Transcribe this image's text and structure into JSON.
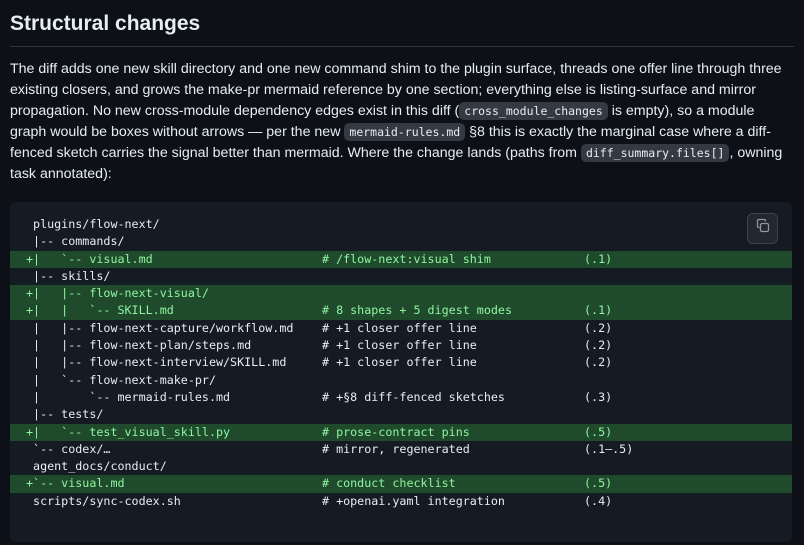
{
  "heading": "Structural changes",
  "paragraph": [
    {
      "t": "The diff adds one new skill directory and one new command shim to the plugin surface, threads one offer line through three existing closers, and grows the make-pr mermaid reference by one section; everything else is listing-surface and mirror propagation. No new cross-module dependency edges exist in this diff ("
    },
    {
      "c": "cross_module_changes"
    },
    {
      "t": " is empty), so a module graph would be boxes without arrows — per the new "
    },
    {
      "c": "mermaid-rules.md"
    },
    {
      "t": " §8 this is exactly the marginal case where a diff-fenced sketch carries the signal better than mermaid. Where the change lands (paths from "
    },
    {
      "c": "diff_summary.files[]"
    },
    {
      "t": ", owning task annotated):"
    }
  ],
  "code": {
    "copy_label": "Copy",
    "lines": [
      {
        "added": false,
        "p": " plugins/flow-next/",
        "c": "",
        "t": ""
      },
      {
        "added": false,
        "p": " |-- commands/",
        "c": "",
        "t": ""
      },
      {
        "added": true,
        "p": "+|   `-- visual.md",
        "c": "# /flow-next:visual shim",
        "t": "(.1)"
      },
      {
        "added": false,
        "p": " |-- skills/",
        "c": "",
        "t": ""
      },
      {
        "added": true,
        "p": "+|   |-- flow-next-visual/",
        "c": "",
        "t": ""
      },
      {
        "added": true,
        "p": "+|   |   `-- SKILL.md",
        "c": "# 8 shapes + 5 digest modes",
        "t": "(.1)"
      },
      {
        "added": false,
        "p": " |   |-- flow-next-capture/workflow.md",
        "c": "# +1 closer offer line",
        "t": "(.2)"
      },
      {
        "added": false,
        "p": " |   |-- flow-next-plan/steps.md",
        "c": "# +1 closer offer line",
        "t": "(.2)"
      },
      {
        "added": false,
        "p": " |   |-- flow-next-interview/SKILL.md",
        "c": "# +1 closer offer line",
        "t": "(.2)"
      },
      {
        "added": false,
        "p": " |   `-- flow-next-make-pr/",
        "c": "",
        "t": ""
      },
      {
        "added": false,
        "p": " |       `-- mermaid-rules.md",
        "c": "# +§8 diff-fenced sketches",
        "t": "(.3)"
      },
      {
        "added": false,
        "p": " |-- tests/",
        "c": "",
        "t": ""
      },
      {
        "added": true,
        "p": "+|   `-- test_visual_skill.py",
        "c": "# prose-contract pins",
        "t": "(.5)"
      },
      {
        "added": false,
        "p": " `-- codex/…",
        "c": "# mirror, regenerated",
        "t": "(.1–.5)"
      },
      {
        "added": false,
        "p": " agent_docs/conduct/",
        "c": "",
        "t": ""
      },
      {
        "added": true,
        "p": "+`-- visual.md",
        "c": "# conduct checklist",
        "t": "(.5)"
      },
      {
        "added": false,
        "p": " scripts/sync-codex.sh",
        "c": "# +openai.yaml integration",
        "t": "(.4)"
      }
    ]
  }
}
